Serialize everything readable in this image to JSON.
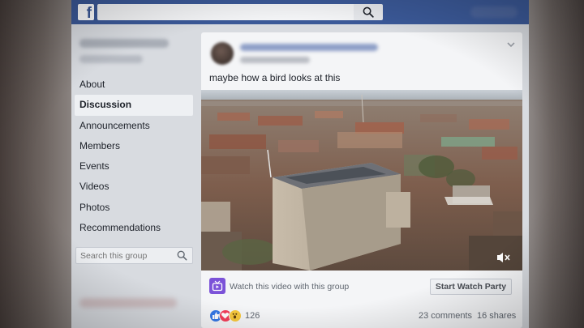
{
  "colors": {
    "brand_blue": "#3b5998",
    "watch_party_purple": "#7b52d8",
    "like_blue": "#3578e5",
    "love_red": "#f33e58",
    "wow_yellow": "#f7c83c"
  },
  "topbar": {
    "logo_letter": "f",
    "search_placeholder": "",
    "search_icon": "search-icon"
  },
  "sidebar": {
    "items": [
      {
        "label": "About",
        "active": false
      },
      {
        "label": "Discussion",
        "active": true
      },
      {
        "label": "Announcements",
        "active": false
      },
      {
        "label": "Members",
        "active": false
      },
      {
        "label": "Events",
        "active": false
      },
      {
        "label": "Videos",
        "active": false
      },
      {
        "label": "Photos",
        "active": false
      },
      {
        "label": "Recommendations",
        "active": false
      }
    ],
    "search_placeholder": "Search this group",
    "search_icon": "search-icon"
  },
  "post": {
    "text": "maybe how a bird looks at this",
    "menu_icon": "chevron-down-icon",
    "video": {
      "mute_icon": "speaker-muted-icon"
    },
    "watch": {
      "icon": "watch-party-icon",
      "label": "Watch this video with this group",
      "button": "Start Watch Party"
    },
    "reactions": {
      "icons": [
        "like-icon",
        "love-icon",
        "wow-icon"
      ],
      "count": "126"
    },
    "comments": "23 comments",
    "shares": "16 shares"
  }
}
